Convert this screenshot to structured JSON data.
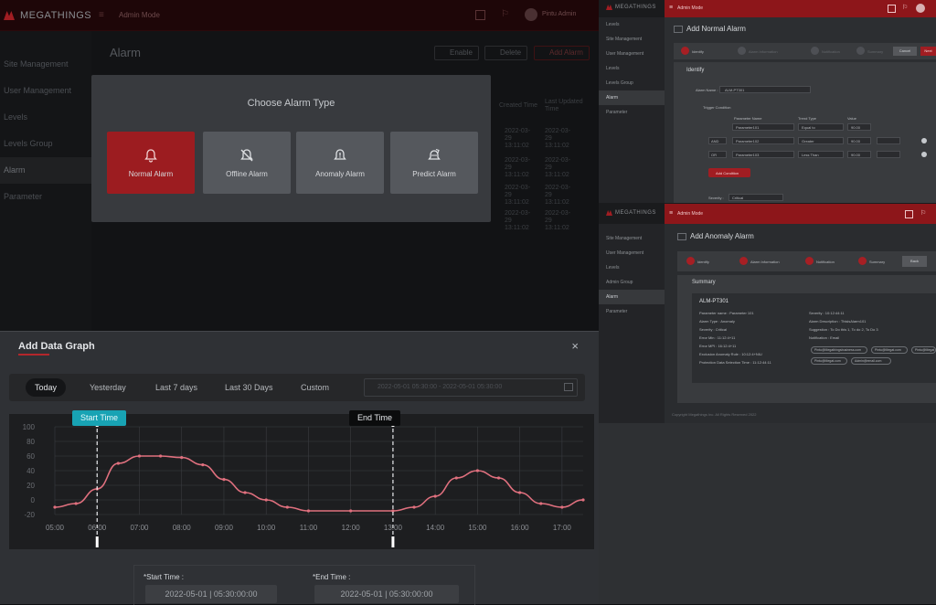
{
  "main_app": {
    "brand": "MEGATHINGS",
    "mode": "Admin Mode",
    "user": "Pintu Admin",
    "page_title": "Alarm",
    "header_buttons": [
      "Enable",
      "Delete",
      "Add Alarm"
    ],
    "sidebar_items": [
      "Site Management",
      "User Management",
      "Levels",
      "Levels Group",
      "Alarm",
      "Parameter"
    ],
    "table_headers": [
      "Created Time",
      "Last Updated Time"
    ],
    "table_rows": [
      [
        "2022-03-29 13:11:02",
        "2022-03-29 13:11:02"
      ],
      [
        "2022-03-29 13:11:02",
        "2022-03-29 13:11:02"
      ],
      [
        "2022-03-29 13:11:02",
        "2022-03-29 13:11:02"
      ],
      [
        "2022-03-29 13:11:02",
        "2022-03-29 13:11:02"
      ]
    ]
  },
  "choose_modal": {
    "title": "Choose Alarm Type",
    "types": [
      {
        "label": "Normal Alarm",
        "icon": "bell-icon",
        "selected": true
      },
      {
        "label": "Offline Alarm",
        "icon": "bell-off-icon",
        "selected": false
      },
      {
        "label": "Anomaly Alarm",
        "icon": "bell-alert-icon",
        "selected": false
      },
      {
        "label": "Predict Alarm",
        "icon": "bell-predict-icon",
        "selected": false
      }
    ]
  },
  "graph_modal": {
    "title": "Add Data Graph",
    "close": "×",
    "ranges": [
      "Today",
      "Yesterday",
      "Last 7 days",
      "Last 30 Days",
      "Custom"
    ],
    "active_range": "Today",
    "date_placeholder": "2022-05-01 05:30:00   -   2022-05-01 05:30:00",
    "start_marker": "Start Time",
    "end_marker": "End Time",
    "start_label": "*Start Time :",
    "end_label": "*End Time :",
    "start_value": "2022-05-01 | 05:30:00:00",
    "end_value": "2022-05-01 | 05:30:00:00"
  },
  "chart_data": {
    "type": "line",
    "x": [
      "05:00",
      "06:00",
      "07:00",
      "08:00",
      "09:00",
      "10:00",
      "11:00",
      "12:00",
      "13:00",
      "14:00",
      "15:00",
      "16:00",
      "17:00"
    ],
    "y_ticks": [
      100,
      80,
      60,
      40,
      20,
      0,
      -20
    ],
    "ylim": [
      -20,
      100
    ],
    "series": [
      {
        "points": [
          [
            5.0,
            -10
          ],
          [
            5.5,
            -5
          ],
          [
            6.0,
            15
          ],
          [
            6.5,
            50
          ],
          [
            7.0,
            60
          ],
          [
            7.5,
            60
          ],
          [
            8.0,
            58
          ],
          [
            8.5,
            48
          ],
          [
            9.0,
            28
          ],
          [
            9.5,
            10
          ],
          [
            10.0,
            0
          ],
          [
            10.5,
            -10
          ],
          [
            11.0,
            -15
          ],
          [
            12.0,
            -15
          ],
          [
            13.0,
            -15
          ],
          [
            13.5,
            -10
          ],
          [
            14.0,
            5
          ],
          [
            14.5,
            30
          ],
          [
            15.0,
            40
          ],
          [
            15.5,
            30
          ],
          [
            16.0,
            10
          ],
          [
            16.5,
            -5
          ],
          [
            17.0,
            -10
          ],
          [
            17.5,
            0
          ]
        ],
        "color": "#e0707e"
      }
    ],
    "start_time_x": 6.0,
    "end_time_x": 13.0,
    "grid": true
  },
  "normal_panel": {
    "brand": "MEGATHINGS",
    "mode": "Admin Mode",
    "title": "Add Normal Alarm",
    "steps": [
      "Identify",
      "Alarm Information",
      "Notification",
      "Summary"
    ],
    "buttons": [
      "Cancel",
      "Next"
    ],
    "section": "Identify",
    "alarm_name_label": "Alarm Name :",
    "alarm_name_value": "ALM-PT301",
    "trigger_label": "Trigger Condition",
    "columns": [
      "Parameter Name",
      "Trend Type",
      "Value"
    ],
    "rows": [
      [
        "Parameter101",
        "Equal to",
        "90.00"
      ],
      [
        "Parameter102",
        "Greater",
        "90.00"
      ],
      [
        "Parameter103",
        "Less Than",
        "90.00"
      ]
    ],
    "logic": [
      "AND",
      "OR"
    ],
    "add_condition": "Add Condition",
    "severity_label": "Severity :",
    "severity_value": "Critical",
    "sidebar_items": [
      "Levels",
      "Site Management",
      "User Management",
      "Levels",
      "Levels Group",
      "Alarm",
      "Parameter"
    ]
  },
  "anomaly_panel": {
    "brand": "MEGATHINGS",
    "mode": "Admin Mode",
    "title": "Add Anomaly Alarm",
    "steps": [
      "Identify",
      "Alarm Information",
      "Notification",
      "Summary"
    ],
    "back": "Back",
    "summary_heading": "Summary",
    "alarm_id": "ALM-PT301",
    "left_lines": [
      "Parameter name :  Parameter 101",
      "Alarm Type : Anomaly",
      "Severity : Critical",
      "Error Min : 11:12:4+11",
      "Error MPI : 16:12:4+11",
      "Exclusion Anomaly Rule : 10:12:4+NIU",
      "Protection Data Selection Time : 11:12:44:11"
    ],
    "right_lines": [
      "Severity : 10:12:44:11",
      "Alarm Description :  ThisisAlarm101",
      "Suggestion : To Do this 1, To do 2, To Do 3",
      "Notification : Email"
    ],
    "tags": [
      "Pintu@Megathingsbusiness.com",
      "Pintu@Megat.com",
      "Pintu@Megat",
      "Pintu@Megat.com",
      "Admin@email.com"
    ],
    "footer": "Copyright Megathings Inc. All Rights Reserved 2022",
    "sidebar_items": [
      "Site Management",
      "User Management",
      "Levels",
      "Admin Group",
      "Alarm",
      "Parameter"
    ]
  },
  "colors": {
    "accent": "#9c1c20",
    "start_marker": "#18a3b4",
    "line": "#e0707e"
  }
}
